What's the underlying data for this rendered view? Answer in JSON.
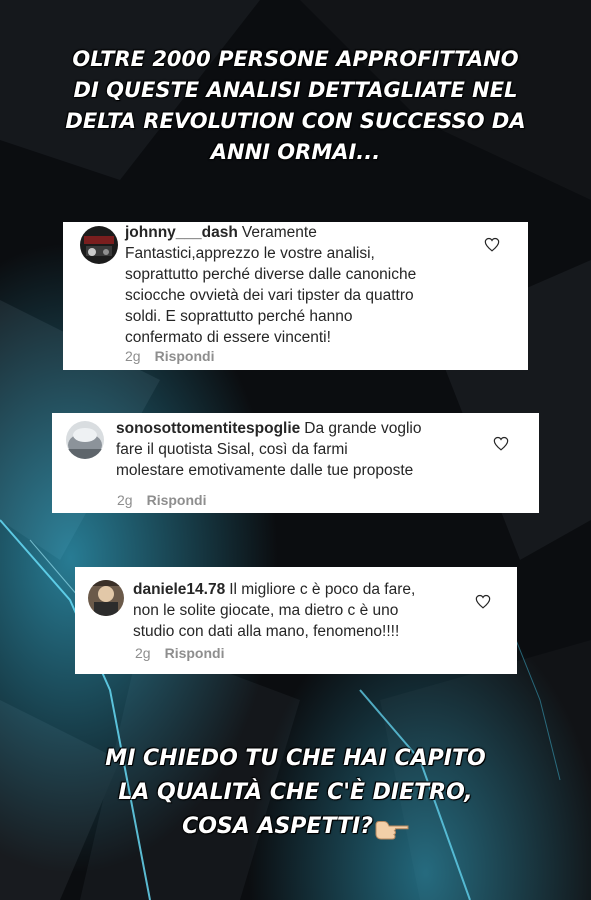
{
  "headline_top": {
    "lines": [
      "OLTRE 2000 PERSONE APPROFITTANO",
      "DI QUESTE ANALISI DETTAGLIATE NEL",
      "DELTA REVOLUTION CON SUCCESSO DA",
      "ANNI ORMAI..."
    ]
  },
  "comments": [
    {
      "username": "johnny___dash",
      "lines": [
        "Veramente",
        "Fantastici,apprezzo le vostre analisi,",
        "soprattutto perché diverse dalle canoniche",
        "sciocche ovvietà dei vari tipster da quattro",
        "soldi. E soprattutto perché hanno",
        "confermato di essere vincenti!"
      ],
      "time": "2g",
      "reply_label": "Rispondi"
    },
    {
      "username": "sonosottomentitespoglie",
      "lines": [
        "Da grande voglio",
        "fare il quotista Sisal, così da farmi",
        "molestare emotivamente dalle tue proposte"
      ],
      "time": "2g",
      "reply_label": "Rispondi"
    },
    {
      "username": "daniele14.78",
      "lines": [
        "Il migliore c è poco da fare,",
        "non le solite giocate, ma dietro c è uno",
        "studio con dati alla mano, fenomeno!!!!"
      ],
      "time": "2g",
      "reply_label": "Rispondi"
    }
  ],
  "headline_bottom": {
    "lines": [
      "MI CHIEDO TU CHE HAI CAPITO",
      "LA QUALITÀ CHE C'È DIETRO,",
      "COSA ASPETTI?"
    ],
    "emoji": "backhand-index-pointing-left"
  },
  "colors": {
    "background": "#0b0d10",
    "accent_glow": "#3fd6ff",
    "card": "#ffffff",
    "text": "#262626",
    "meta": "#8e8e8e"
  }
}
